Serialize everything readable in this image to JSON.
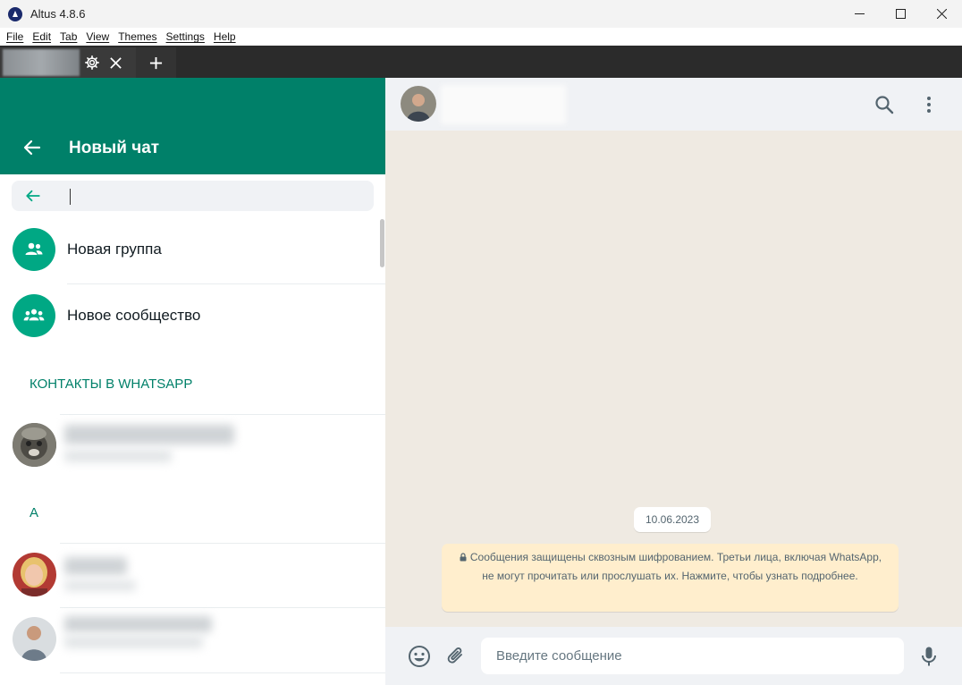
{
  "window": {
    "title": "Altus 4.8.6"
  },
  "menu": [
    "File",
    "Edit",
    "Tab",
    "View",
    "Themes",
    "Settings",
    "Help"
  ],
  "tabs": {
    "add_label": "+"
  },
  "left": {
    "header_title": "Новый чат",
    "search": {
      "placeholder": ""
    },
    "actions": [
      {
        "label": "Новая группа",
        "icon": "group-icon"
      },
      {
        "label": "Новое сообщество",
        "icon": "community-icon"
      }
    ],
    "sections": {
      "contacts": "КОНТАКТЫ В WHATSAPP",
      "letter_a": "А"
    }
  },
  "chat": {
    "date": "10.06.2023",
    "encryption_notice": "Сообщения защищены сквозным шифрованием. Третьи лица, включая WhatsApp, не могут прочитать или прослушать их. Нажмите, чтобы узнать подробнее.",
    "input_placeholder": "Введите сообщение"
  },
  "colors": {
    "brand": "#008069",
    "accent": "#00a884",
    "chat_bg": "#efeae2",
    "notice_bg": "#ffeecd"
  }
}
